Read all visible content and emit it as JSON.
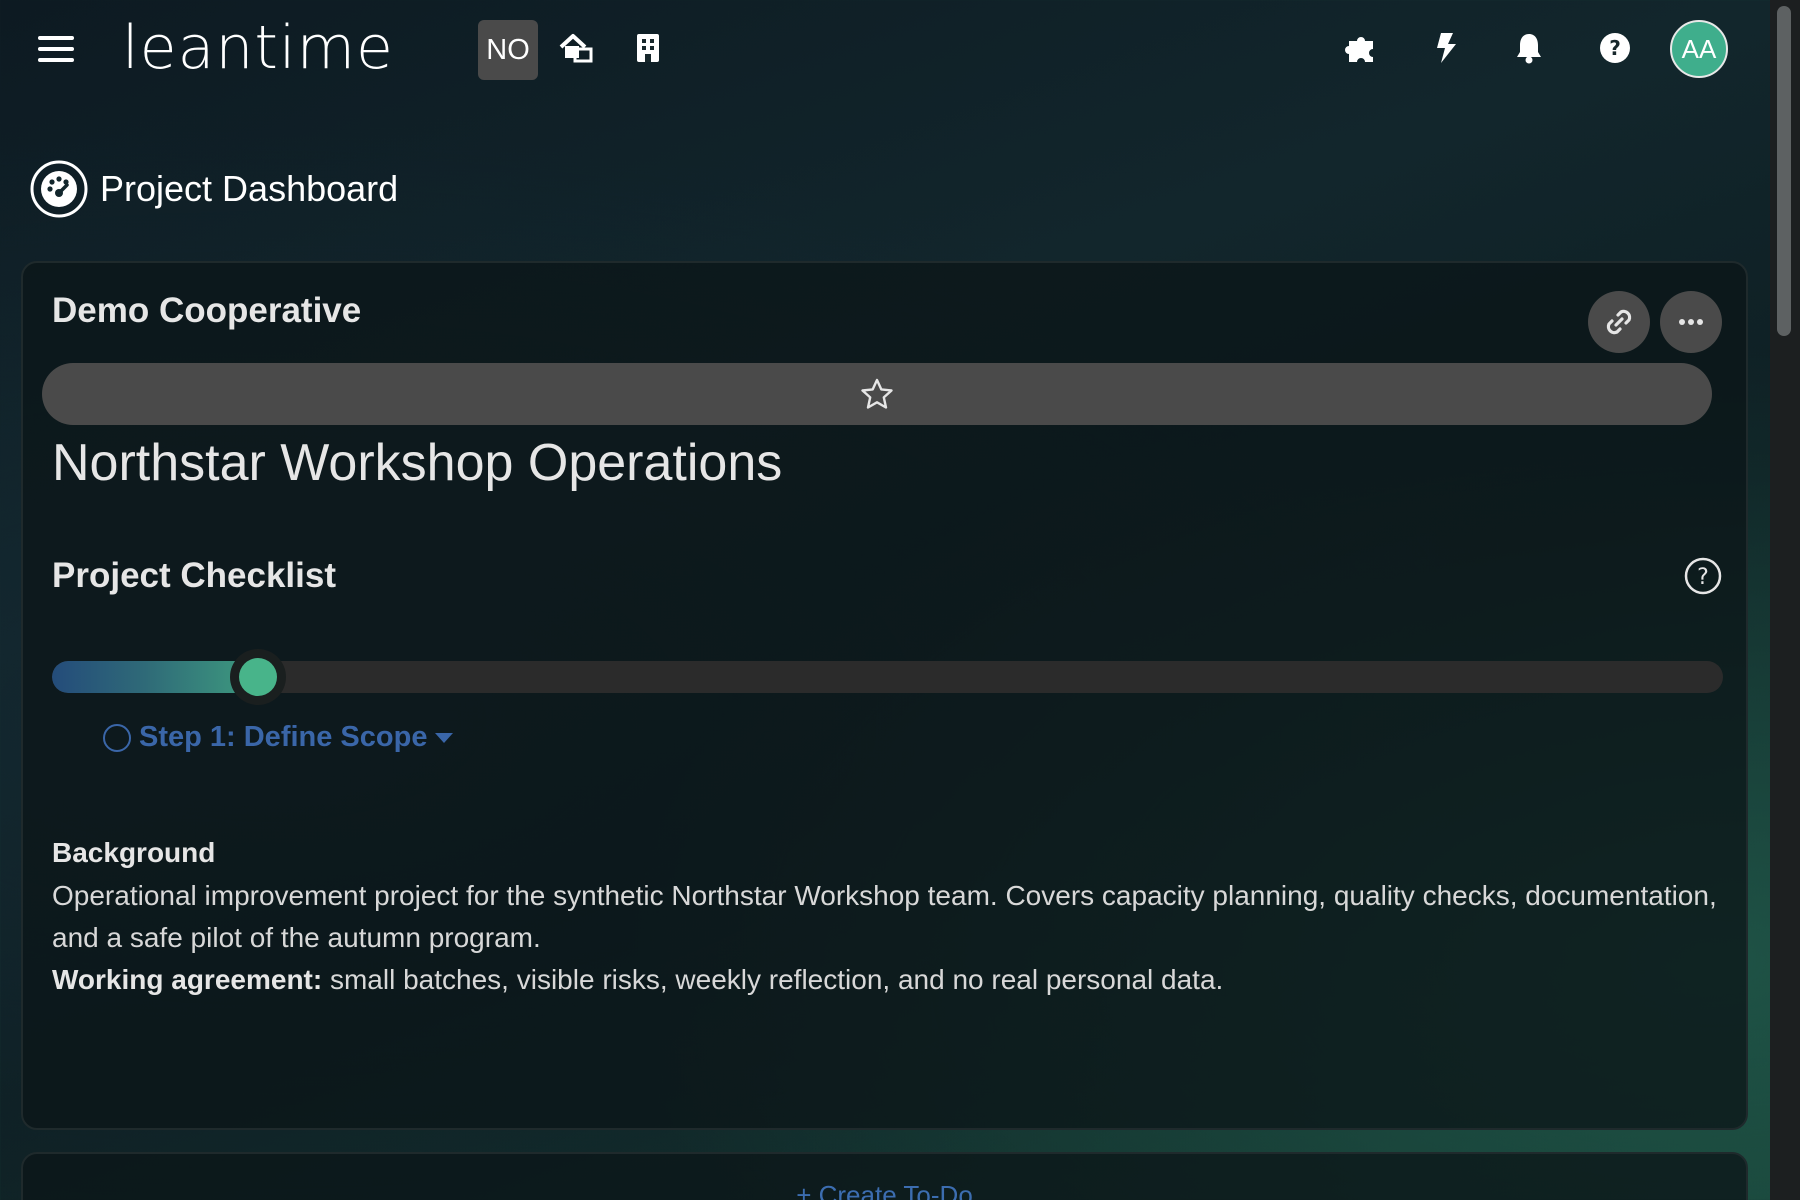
{
  "app": {
    "logo_text": "leantime",
    "project_badge": "NO",
    "avatar_initials": "AA"
  },
  "topbar": {
    "icons": [
      "hamburger-menu-icon",
      "home-icon",
      "building-icon",
      "puzzle-icon",
      "bolt-icon",
      "bell-icon",
      "question-icon"
    ]
  },
  "page": {
    "title": "Project Dashboard"
  },
  "project_card": {
    "client_name": "Demo Cooperative",
    "project_name": "Northstar Workshop Operations",
    "checklist_title": "Project Checklist",
    "progress_fraction": 0.123,
    "current_step": "Step 1: Define Scope",
    "background_heading": "Background",
    "background_text": "Operational improvement project for the synthetic Northstar Workshop team. Covers capacity planning, quality checks, documentation, and a safe pilot of the autumn program.",
    "working_agreement_label": "Working agreement:",
    "working_agreement_text": " small batches, visible risks, weekly reflection, and no real personal data."
  },
  "todo_card": {
    "create_label": "+ Create To-Do"
  },
  "colors": {
    "accent_green": "#48b48a",
    "link_blue": "#3a66a8",
    "badge_gray": "#4a4a4a"
  }
}
